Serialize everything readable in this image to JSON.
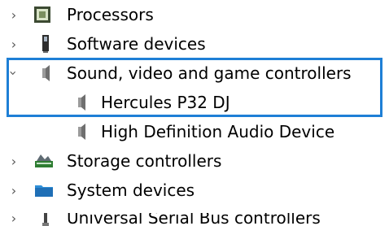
{
  "tree": {
    "items": [
      {
        "label": "Processors",
        "icon": "processor-icon",
        "chevron": "chevron-right"
      },
      {
        "label": "Software devices",
        "icon": "software-device-icon",
        "chevron": "chevron-right"
      },
      {
        "label": "Sound, video and game controllers",
        "icon": "speaker-icon",
        "chevron": "chevron-down"
      },
      {
        "label": "Hercules P32 DJ",
        "icon": "speaker-icon",
        "chevron": ""
      },
      {
        "label": "High Definition Audio Device",
        "icon": "speaker-icon",
        "chevron": ""
      },
      {
        "label": "Storage controllers",
        "icon": "storage-controller-icon",
        "chevron": "chevron-right"
      },
      {
        "label": "System devices",
        "icon": "system-devices-icon",
        "chevron": "chevron-right"
      },
      {
        "label": "Universal Serial Bus controllers",
        "icon": "usb-icon",
        "chevron": "chevron-right"
      }
    ]
  },
  "colors": {
    "selection_border": "#1e7fd6",
    "chevron": "#555555"
  }
}
